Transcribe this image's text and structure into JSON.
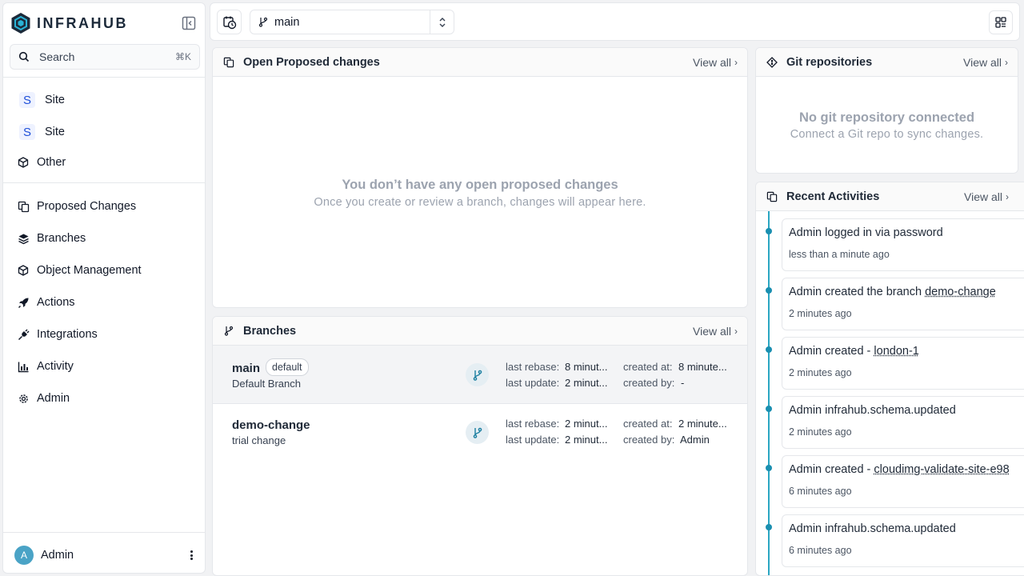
{
  "app": {
    "name": "INFRAHUB"
  },
  "search": {
    "label": "Search",
    "shortcut": "⌘K"
  },
  "sidebar": {
    "schema_items": [
      {
        "label": "Site",
        "badge": "S"
      },
      {
        "label": "Site",
        "badge": "S"
      },
      {
        "label": "Other"
      }
    ],
    "nav_items": [
      {
        "label": "Proposed Changes",
        "icon": "proposed-changes-icon"
      },
      {
        "label": "Branches",
        "icon": "layers-icon"
      },
      {
        "label": "Object Management",
        "icon": "cube-icon"
      },
      {
        "label": "Actions",
        "icon": "rocket-icon"
      },
      {
        "label": "Integrations",
        "icon": "plug-icon"
      },
      {
        "label": "Activity",
        "icon": "chart-icon"
      },
      {
        "label": "Admin",
        "icon": "gear-icon"
      }
    ],
    "user": {
      "initial": "A",
      "name": "Admin"
    }
  },
  "topbar": {
    "branch": "main"
  },
  "proposed_changes": {
    "title": "Open Proposed changes",
    "view_all": "View all",
    "empty_title": "You don’t have any open proposed changes",
    "empty_sub": "Once you create or review a branch, changes will appear here."
  },
  "branches": {
    "title": "Branches",
    "view_all": "View all",
    "labels": {
      "last_rebase": "last rebase:",
      "last_update": "last update:",
      "created_at": "created at:",
      "created_by": "created by:"
    },
    "rows": [
      {
        "name": "main",
        "badge": "default",
        "description": "Default Branch",
        "last_rebase": "8 minut...",
        "last_update": "2 minut...",
        "created_at": "8 minute...",
        "created_by": "-"
      },
      {
        "name": "demo-change",
        "description": "trial change",
        "last_rebase": "2 minut...",
        "last_update": "2 minut...",
        "created_at": "2 minute...",
        "created_by": "Admin"
      }
    ]
  },
  "git": {
    "title": "Git repositories",
    "view_all": "View all",
    "empty_title": "No git repository connected",
    "empty_sub": "Connect a Git repo to sync changes."
  },
  "activities": {
    "title": "Recent Activities",
    "view_all": "View all",
    "items": [
      {
        "actor": "Admin",
        "text": "logged in via password",
        "target": "",
        "time": "less than a minute ago"
      },
      {
        "actor": "Admin",
        "text": "created the branch",
        "target": "demo-change",
        "time": "2 minutes ago"
      },
      {
        "actor": "Admin",
        "text": "created -",
        "target": "london-1",
        "time": "2 minutes ago"
      },
      {
        "actor": "Admin",
        "text": "infrahub.schema.updated",
        "target": "",
        "time": "2 minutes ago"
      },
      {
        "actor": "Admin",
        "text": "created -",
        "target": "cloudimg-validate-site-e98",
        "time": "6 minutes ago"
      },
      {
        "actor": "Admin",
        "text": "infrahub.schema.updated",
        "target": "",
        "time": "6 minutes ago"
      }
    ]
  }
}
